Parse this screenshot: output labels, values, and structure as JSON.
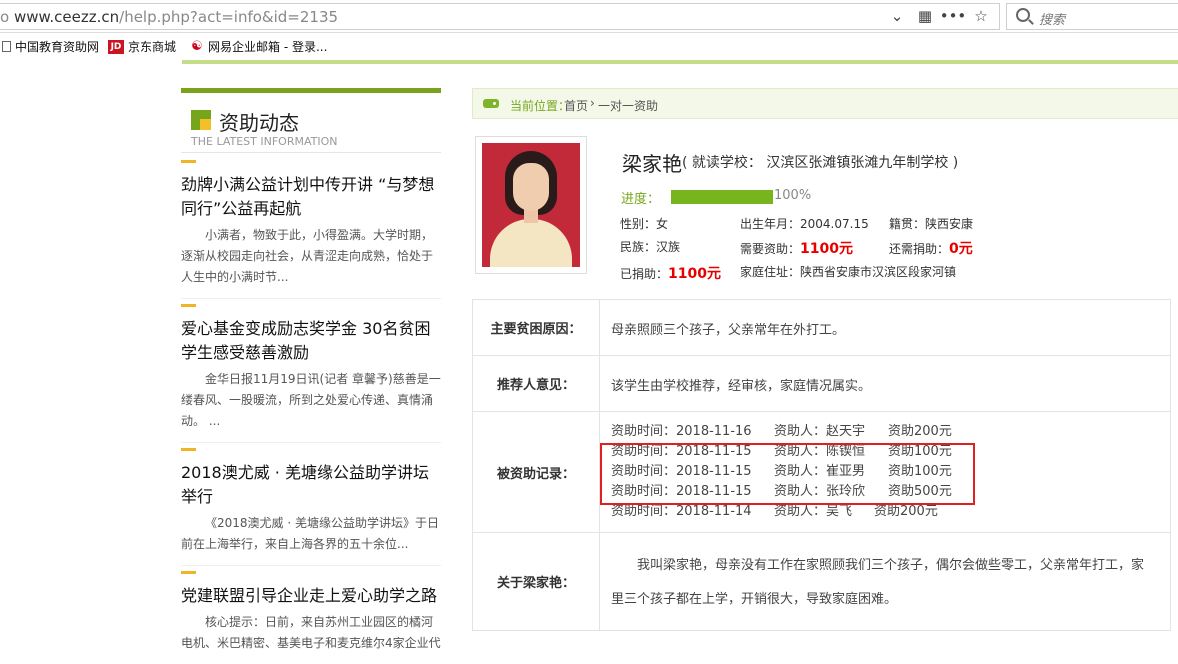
{
  "browser": {
    "url_host": "www.ceezz.cn",
    "url_path": "/help.php?act=info&id=2135",
    "url_prefix": "o",
    "search_placeholder": "搜索",
    "bookmarks": [
      {
        "label": "中国教育资助网",
        "icon": "page-icon"
      },
      {
        "label": "京东商城",
        "icon": "jd-icon",
        "icon_text": "JD"
      },
      {
        "label": "网易企业邮箱 - 登录...",
        "icon": "netease-icon"
      }
    ]
  },
  "left": {
    "section_title": "资助动态",
    "section_subtitle": "THE LATEST INFORMATION",
    "news": [
      {
        "title": "劲牌小满公益计划中传开讲 “与梦想同行”公益再起航",
        "desc": "小满者，物致于此，小得盈满。大学时期，逐渐从校园走向社会，从青涩走向成熟，恰处于人生中的小满时节..."
      },
      {
        "title": "爱心基金变成励志奖学金 30名贫困学生感受慈善激励",
        "desc": "金华日报11月19日讯(记者 章馨予)慈善是一缕春风、一股暖流，所到之处爱心传递、真情涌动。 ..."
      },
      {
        "title": "2018澳尤威 · 羌塘缘公益助学讲坛举行",
        "desc": "《2018澳尤威 · 羌塘缘公益助学讲坛》于日前在上海举行，来自上海各界的五十余位..."
      },
      {
        "title": "党建联盟引导企业走上爱心助学之路",
        "desc": "核心提示：日前，来自苏州工业园区的橘河电机、米巴精密、基美电子和麦克维尔4家企业代"
      }
    ]
  },
  "breadcrumb": {
    "label": "当前位置：",
    "home": "首页",
    "current": "一对一资助"
  },
  "profile": {
    "name": "梁家艳",
    "school": "( 就读学校： 汉滨区张滩镇张滩九年制学校 )",
    "progress_label": "进度：",
    "progress_text": "100%",
    "progress_fraction": 1.0,
    "gender": "性别：女",
    "birth": "出生年月：2004.07.15",
    "native": "籍贯：陕西安康",
    "ethnic": "民族：汉族",
    "need_label": "需要资助：",
    "need_value": "1100元",
    "remain_label": "还需捐助：",
    "remain_value": "0元",
    "donated_label": "已捐助：",
    "donated_value": "1100元",
    "address": "家庭住址：陕西省安康市汉滨区段家河镇"
  },
  "details": {
    "reason_label": "主要贫困原因：",
    "reason": "母亲照顾三个孩子，父亲常年在外打工。",
    "recommend_label": "推荐人意见：",
    "recommend": "该学生由学校推荐，经审核，家庭情况属实。",
    "records_label": "被资助记录：",
    "records": [
      {
        "time": "资助时间：2018-11-16",
        "donor": "资助人：赵天宇",
        "amount": "资助200元"
      },
      {
        "time": "资助时间：2018-11-15",
        "donor": "资助人：陈锲恒",
        "amount": "资助100元"
      },
      {
        "time": "资助时间：2018-11-15",
        "donor": "资助人：崔亚男",
        "amount": "资助100元"
      },
      {
        "time": "资助时间：2018-11-15",
        "donor": "资助人：张玲欣",
        "amount": "资助500元"
      },
      {
        "time": "资助时间：2018-11-14",
        "donor": "资助人：吴飞",
        "amount": "资助200元"
      }
    ],
    "about_label": "关于梁家艳：",
    "about": "我叫梁家艳，母亲没有工作在家照顾我们三个孩子，偶尔会做些零工，父亲常年打工，家里三个孩子都在上学，开销很大，导致家庭困难。"
  }
}
